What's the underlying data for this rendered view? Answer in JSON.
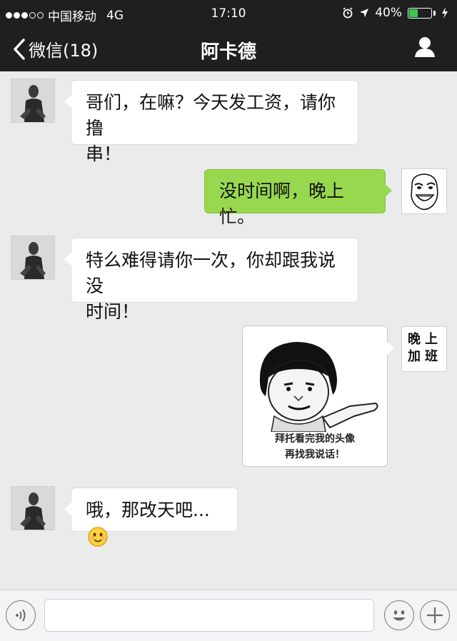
{
  "status_bar": {
    "carrier": "中国移动",
    "network": "4G",
    "time": "17:10",
    "battery_percent": "40%",
    "battery_level": 0.4
  },
  "nav": {
    "back_label": "微信(18)",
    "title": "阿卡德"
  },
  "messages": [
    {
      "side": "left",
      "text_line1": "哥们，在嘛？今天发工资，请你撸",
      "text_line2": "串！"
    },
    {
      "side": "right",
      "text": "没时间啊，晚上忙。"
    },
    {
      "side": "left",
      "text_line1": "特么难得请你一次，你却跟我说没",
      "text_line2": "时间！"
    },
    {
      "side": "right",
      "type": "image",
      "caption_line1": "拜托看完我的头像",
      "caption_line2": "再找我说话！"
    },
    {
      "side": "left",
      "text": "哦，那改天吧..."
    }
  ],
  "self_avatar_label": "晚上加班",
  "colors": {
    "header_bg": "#1f1f1f",
    "chat_bg": "#ebebeb",
    "sent_bubble": "#97d84f",
    "received_bubble": "#ffffff",
    "battery": "#3ac94b"
  },
  "input_bar": {
    "value": ""
  }
}
